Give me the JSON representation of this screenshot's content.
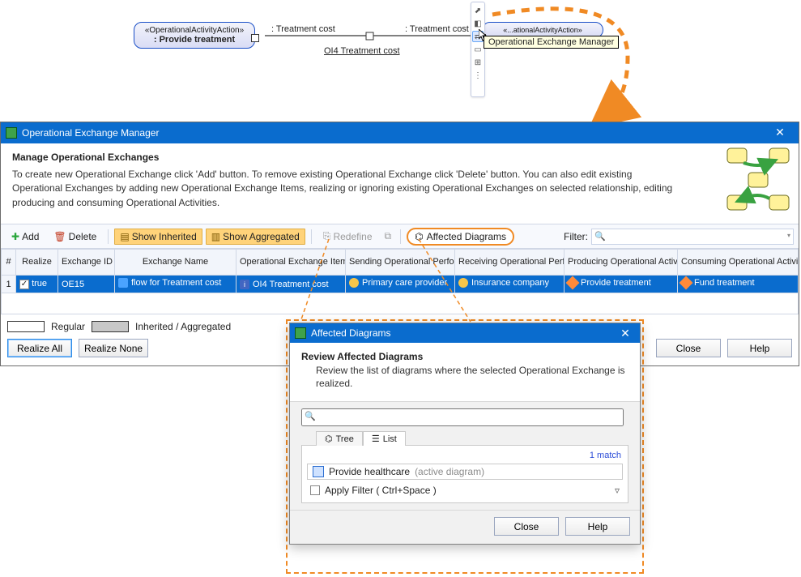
{
  "diagram": {
    "stereo": "«OperationalActivityAction»",
    "left_name": ": Provide treatment",
    "right_name": "",
    "edge_label": ": Treatment cost",
    "center_label": "OI4 Treatment cost",
    "tooltip": "Operational Exchange Manager"
  },
  "dialog": {
    "title": "Operational Exchange Manager",
    "heading": "Manage Operational Exchanges",
    "desc": "To create new Operational Exchange click 'Add' button. To remove existing Operational Exchange click 'Delete' button. You can also edit existing Operational Exchanges by adding new Operational Exchange Items, realizing or ignoring existing Operational Exchanges on selected relationship, editing producing and consuming Operational Activities."
  },
  "toolbar": {
    "add": "Add",
    "delete": "Delete",
    "show_inherited": "Show Inherited",
    "show_aggregated": "Show Aggregated",
    "redefine": "Redefine",
    "affected": "Affected Diagrams",
    "filter_label": "Filter:"
  },
  "columns": {
    "num": "#",
    "realize": "Realize",
    "exchange_id": "Exchange ID",
    "exchange_name": "Exchange Name",
    "item": "Operational Exchange Item",
    "sender": "Sending Operational Performer",
    "receiver": "Receiving Operational Performer",
    "producer": "Producing Operational Activity",
    "consumer": "Consuming Operational Activity"
  },
  "rows": [
    {
      "num": "1",
      "realize": "true",
      "exchange_id": "OE15",
      "exchange_name": "flow for Treatment cost",
      "item": "OI4 Treatment cost",
      "sender": "Primary care provider",
      "receiver": "Insurance company",
      "producer": "Provide treatment",
      "consumer": "Fund treatment"
    }
  ],
  "legend": {
    "regular": "Regular",
    "inh": "Inherited / Aggregated"
  },
  "buttons": {
    "realize_all": "Realize All",
    "realize_none": "Realize None",
    "close": "Close",
    "help": "Help"
  },
  "popup": {
    "title": "Affected Diagrams",
    "heading": "Review Affected Diagrams",
    "desc": "Review the list of diagrams where the selected Operational Exchange is realized.",
    "tab_tree": "Tree",
    "tab_list": "List",
    "match": "1 match",
    "item_name": "Provide healthcare",
    "item_suffix": "(active diagram)",
    "apply": "Apply Filter ( Ctrl+Space )",
    "close": "Close",
    "help": "Help"
  }
}
